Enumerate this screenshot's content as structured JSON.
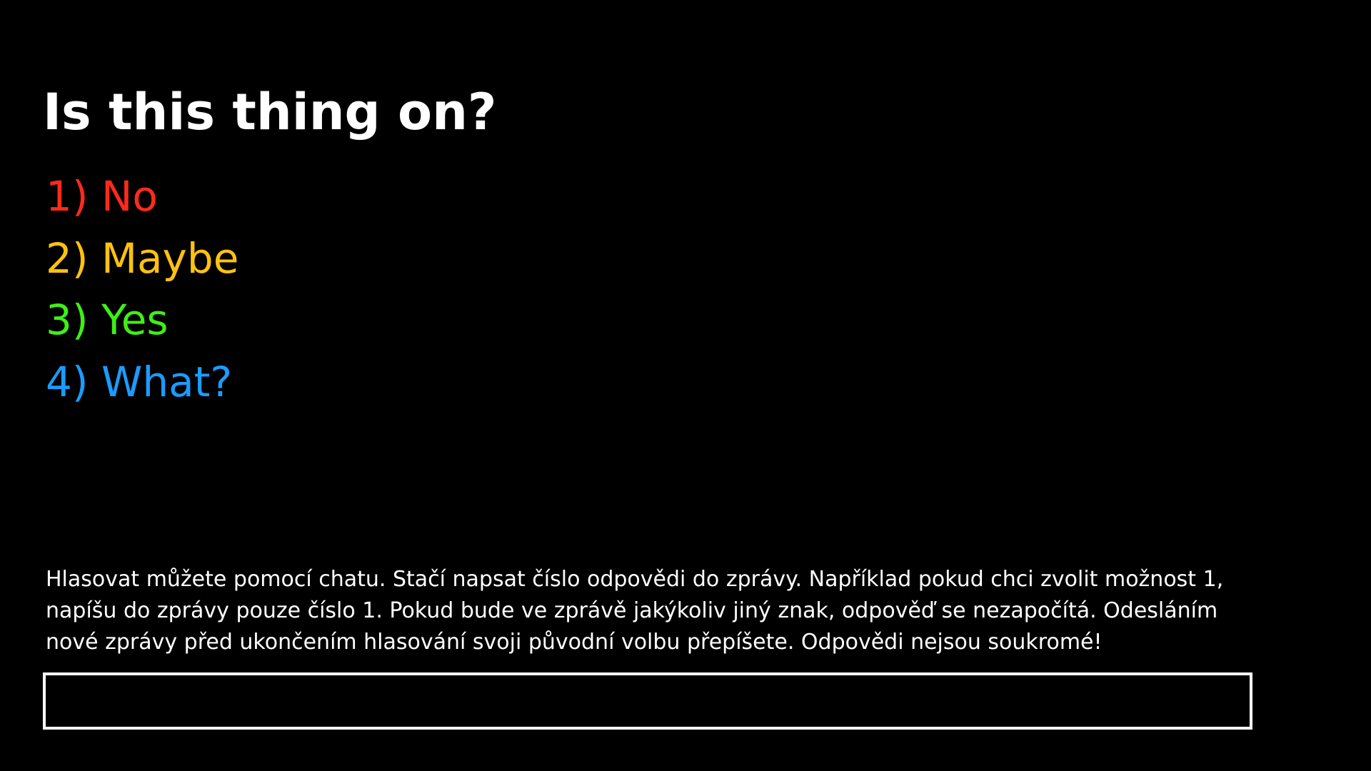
{
  "poll": {
    "question": "Is this thing on?",
    "options": [
      {
        "label": "1) No",
        "color": "#ff2a1a"
      },
      {
        "label": "2) Maybe",
        "color": "#ffc20e"
      },
      {
        "label": "3) Yes",
        "color": "#3ef014"
      },
      {
        "label": "4) What?",
        "color": "#1a9cff"
      }
    ],
    "instructions": "Hlasovat můžete pomocí chatu. Stačí napsat číslo odpovědi do zprávy. Například pokud chci zvolit možnost 1, napíšu do zprávy pouze číslo 1. Pokud bude ve zprávě jakýkoliv jiný znak, odpověď se nezapočítá. Odesláním nové zprávy před ukončením hlasování svoji původní volbu přepíšete. Odpovědi nejsou soukromé!"
  }
}
